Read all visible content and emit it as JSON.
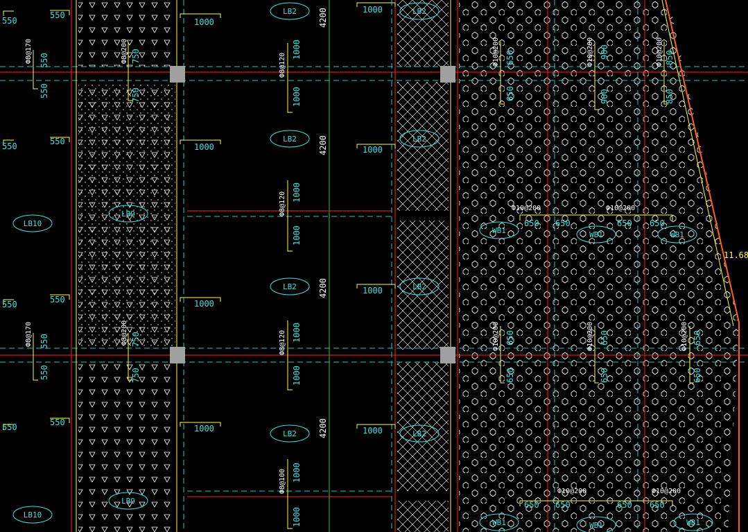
{
  "colors": {
    "background": "#000000",
    "slab_edge": "#ff2020",
    "dashed_axis": "#20c8c8",
    "beam_line": "#ffff40",
    "label": "#40e0e0",
    "dimension_text": "#ffffff",
    "hatch": "#ffffff",
    "green_axis": "#40c040",
    "magenta": "#c040c0",
    "column_fill": "#a0a0a0",
    "edge_orange": "#ff6020"
  },
  "slab_labels": {
    "lb2_1": "LB2",
    "lb2_2": "LB2",
    "lb2_3": "LB2",
    "lb2_4": "LB2",
    "lb2_5": "LB2",
    "lb2_6": "LB2",
    "lb2_7": "LB2",
    "lb2_8": "LB2",
    "lb9_1": "LB9",
    "lb9_2": "LB9",
    "lb10_1": "LB10",
    "lb10_2": "LB10",
    "wb1_1": "WB1",
    "wb1_2": "WB1",
    "wb1_3": "WB1",
    "wb1_4": "WB1",
    "wb1_5": "WB1",
    "wb1_6": "WB1"
  },
  "dimensions": {
    "d550": "550",
    "d1000": "1000",
    "d4200": "4200",
    "d650": "650",
    "d850": "850",
    "d900": "900",
    "d750": "750"
  },
  "rebar": {
    "phi8_170": "Ф8@170",
    "phi8_200": "Ф8@200",
    "phi8_120": "Ф8@120",
    "phi8_100": "Ф8@100",
    "phi10_200": "Ф10@200"
  },
  "angle": "11.68°"
}
